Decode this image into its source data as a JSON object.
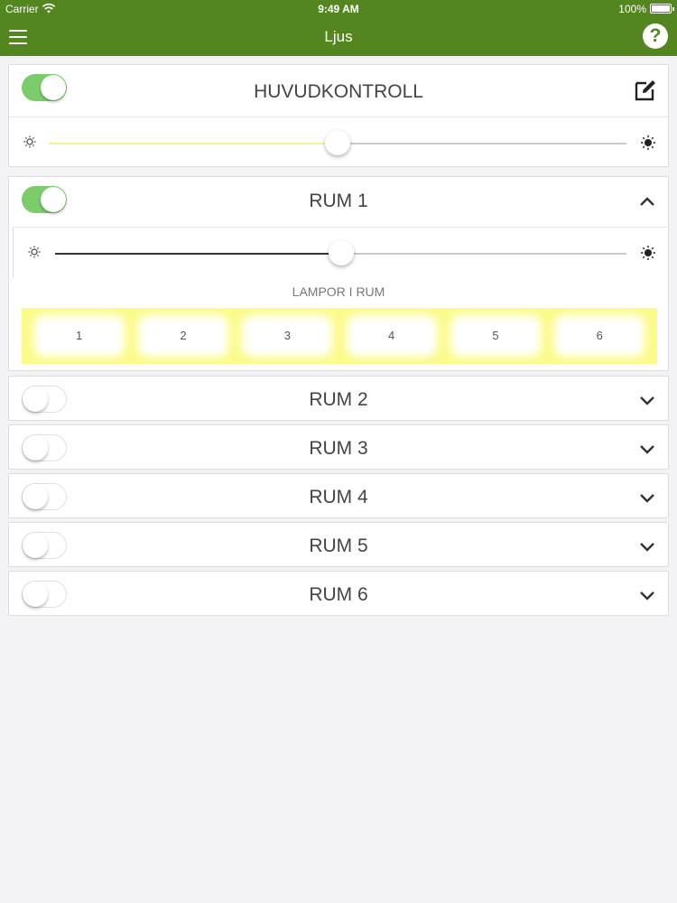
{
  "status_bar": {
    "carrier": "Carrier",
    "time": "9:49 AM",
    "battery": "100%"
  },
  "nav": {
    "title": "Ljus",
    "help_label": "?"
  },
  "colors": {
    "brand": "#54861f",
    "toggle_on": "#7ccc6c",
    "master_fill": "#f3f39a",
    "lamp_area": "#fbfb8a"
  },
  "master": {
    "title": "HUVUDKONTROLL",
    "on": true,
    "brightness": 0.5
  },
  "rooms": [
    {
      "title": "RUM 1",
      "on": true,
      "expanded": true,
      "brightness": 0.5,
      "lamps_label": "LAMPOR I RUM",
      "lamps": [
        "1",
        "2",
        "3",
        "4",
        "5",
        "6"
      ]
    },
    {
      "title": "RUM 2",
      "on": false,
      "expanded": false
    },
    {
      "title": "RUM 3",
      "on": false,
      "expanded": false
    },
    {
      "title": "RUM 4",
      "on": false,
      "expanded": false
    },
    {
      "title": "RUM 5",
      "on": false,
      "expanded": false
    },
    {
      "title": "RUM 6",
      "on": false,
      "expanded": false
    }
  ],
  "icons": {
    "menu": "hamburger-icon",
    "help": "help-icon",
    "edit": "edit-icon",
    "sun_low": "sun-low-icon",
    "sun_high": "sun-high-icon"
  }
}
